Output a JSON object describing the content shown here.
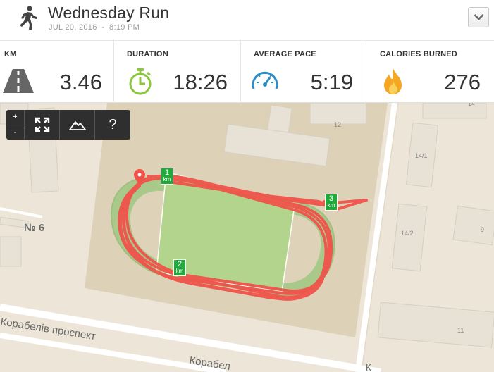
{
  "activity": {
    "title": "Wednesday Run",
    "date": "JUL 20, 2016",
    "separator": "-",
    "time": "8:19 PM"
  },
  "stats": [
    {
      "label": "KM",
      "value": "3.46",
      "icon": "road-icon"
    },
    {
      "label": "DURATION",
      "value": "18:26",
      "icon": "stopwatch-icon"
    },
    {
      "label": "AVERAGE PACE",
      "value": "5:19",
      "icon": "speedometer-icon"
    },
    {
      "label": "CALORIES BURNED",
      "value": "276",
      "icon": "flame-icon"
    }
  ],
  "map_controls": {
    "zoom_in": "+",
    "zoom_out": "-",
    "fullscreen_icon": "expand-icon",
    "terrain_icon": "mountain-icon",
    "help": "?"
  },
  "map": {
    "labels": {
      "street_1": "Корабелів проспект",
      "street_2": "Корабел",
      "area": "№ 6",
      "bldg_12": "12",
      "bldg_14": "14",
      "bldg_14_1": "14/1",
      "bldg_14_2": "14/2",
      "bldg_9": "9",
      "bldg_11": "11",
      "edge_k": "К"
    },
    "markers": {
      "km1": {
        "num": "1",
        "unit": "km"
      },
      "km2": {
        "num": "2",
        "unit": "km"
      },
      "km3": {
        "num": "3",
        "unit": "km"
      }
    }
  },
  "colors": {
    "route": "#f0534a",
    "start_pin": "#f0534a",
    "marker": "#1faa3a",
    "field": "#b2d48c",
    "stopwatch": "#8cc63f",
    "speedometer": "#2b8fc7",
    "flame": "#f5a623"
  }
}
